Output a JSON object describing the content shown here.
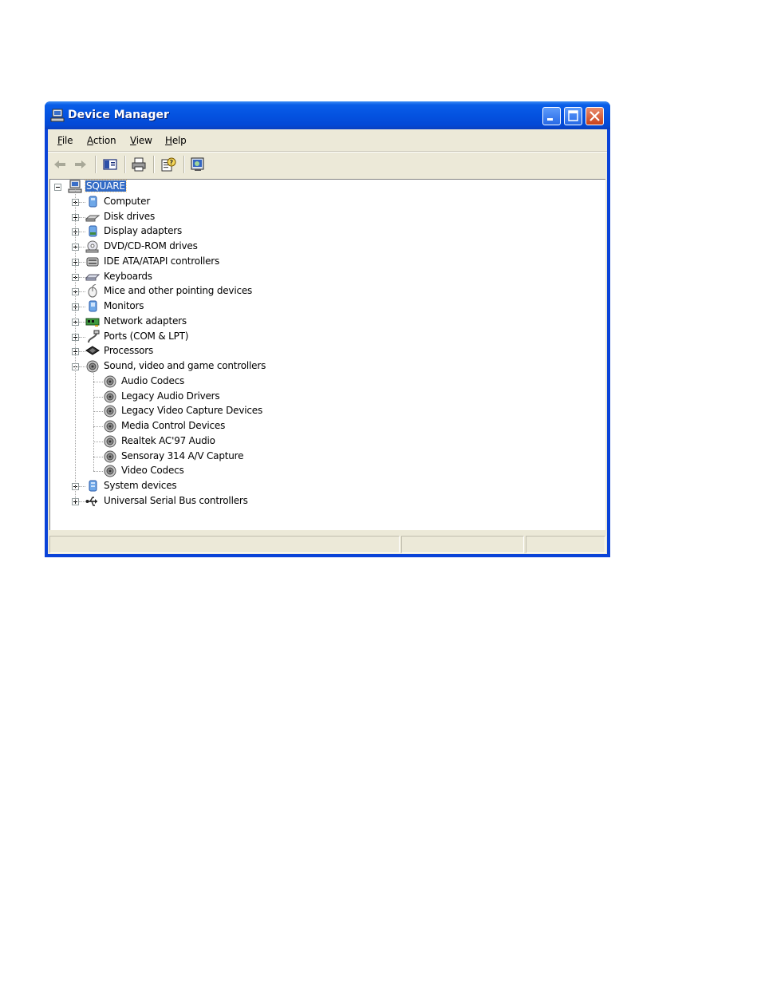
{
  "window": {
    "title": "Device Manager",
    "colors": {
      "titlebar": "#0452e0",
      "selection": "#316ac5",
      "chrome": "#ece9d8"
    }
  },
  "menu": [
    {
      "underline": "F",
      "rest": "ile"
    },
    {
      "underline": "A",
      "rest": "ction"
    },
    {
      "underline": "V",
      "rest": "iew"
    },
    {
      "underline": "H",
      "rest": "elp"
    }
  ],
  "toolbar_icons": [
    "back-arrow-icon",
    "forward-arrow-icon",
    "show-hide-console-tree-icon",
    "print-icon",
    "properties-help-icon",
    "scan-hardware-icon"
  ],
  "tree": {
    "root": "SQUARE",
    "categories": [
      {
        "label": "Computer",
        "icon": "computer-icon",
        "expanded": false
      },
      {
        "label": "Disk drives",
        "icon": "disk-drive-icon",
        "expanded": false
      },
      {
        "label": "Display adapters",
        "icon": "display-adapter-icon",
        "expanded": false
      },
      {
        "label": "DVD/CD-ROM drives",
        "icon": "dvd-drive-icon",
        "expanded": false
      },
      {
        "label": "IDE ATA/ATAPI controllers",
        "icon": "ide-controller-icon",
        "expanded": false
      },
      {
        "label": "Keyboards",
        "icon": "keyboard-icon",
        "expanded": false
      },
      {
        "label": "Mice and other pointing devices",
        "icon": "mouse-icon",
        "expanded": false
      },
      {
        "label": "Monitors",
        "icon": "monitor-icon",
        "expanded": false
      },
      {
        "label": "Network adapters",
        "icon": "network-adapter-icon",
        "expanded": false
      },
      {
        "label": "Ports (COM & LPT)",
        "icon": "port-icon",
        "expanded": false
      },
      {
        "label": "Processors",
        "icon": "processor-icon",
        "expanded": false
      },
      {
        "label": "Sound, video and game controllers",
        "icon": "speaker-icon",
        "expanded": true
      },
      {
        "label": "System devices",
        "icon": "system-device-icon",
        "expanded": false
      },
      {
        "label": "Universal Serial Bus controllers",
        "icon": "usb-icon",
        "expanded": false
      }
    ],
    "sound_children": [
      "Audio Codecs",
      "Legacy Audio Drivers",
      "Legacy Video Capture Devices",
      "Media Control Devices",
      "Realtek AC'97 Audio",
      "Sensoray 314 A/V Capture",
      "Video Codecs"
    ]
  }
}
